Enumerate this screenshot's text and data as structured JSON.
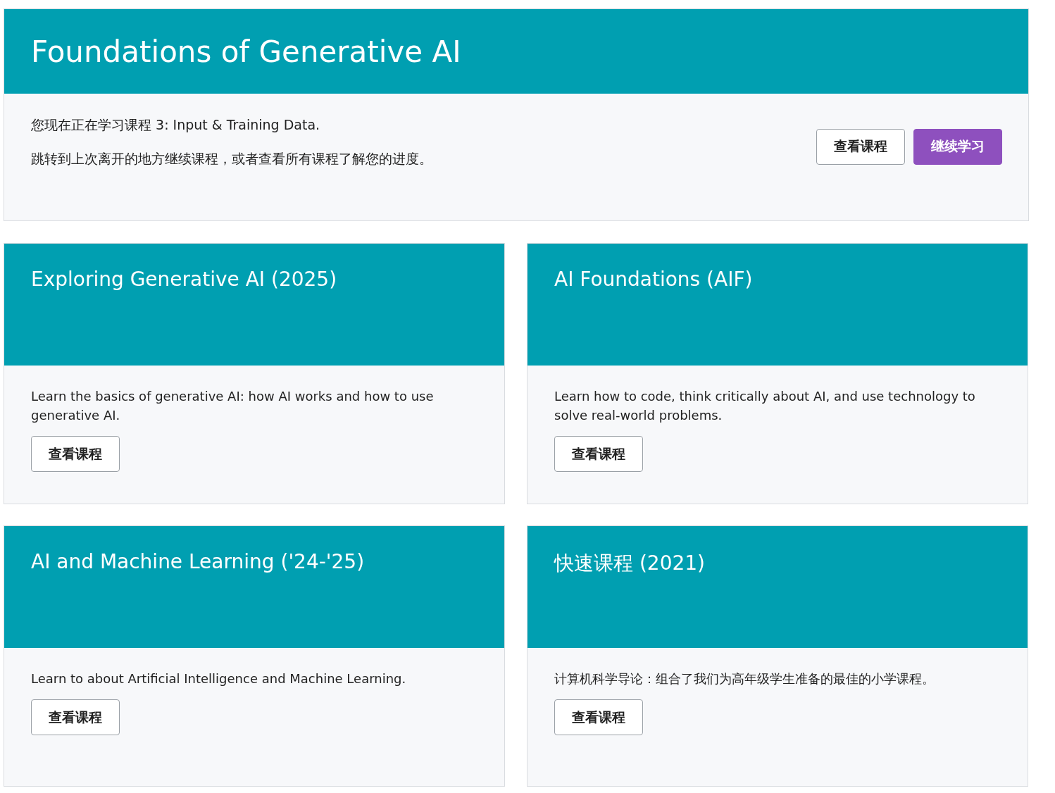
{
  "banner": {
    "title": "Foundations of Generative AI",
    "lines": [
      "您现在正在学习课程 3: Input & Training Data.",
      "跳转到上次离开的地方继续课程，或者查看所有课程了解您的进度。"
    ],
    "buttons": [
      {
        "label": "查看课程",
        "kind": "secondary"
      },
      {
        "label": "继续学习",
        "kind": "primary"
      }
    ]
  },
  "courses": [
    {
      "title": "Exploring Generative AI (2025)",
      "description": "Learn the basics of generative AI: how AI works and how to use generative AI.",
      "button": "查看课程"
    },
    {
      "title": "AI Foundations (AIF)",
      "description": "Learn how to code, think critically about AI, and use technology to solve real-world problems.",
      "button": "查看课程"
    },
    {
      "title": "AI and Machine Learning ('24-'25)",
      "description": "Learn to about Artificial Intelligence and Machine Learning.",
      "button": "查看课程"
    },
    {
      "title": "快速课程 (2021)",
      "description": "计算机科学导论：组合了我们为高年级学生准备的最佳的小学课程。",
      "button": "查看课程"
    }
  ]
}
